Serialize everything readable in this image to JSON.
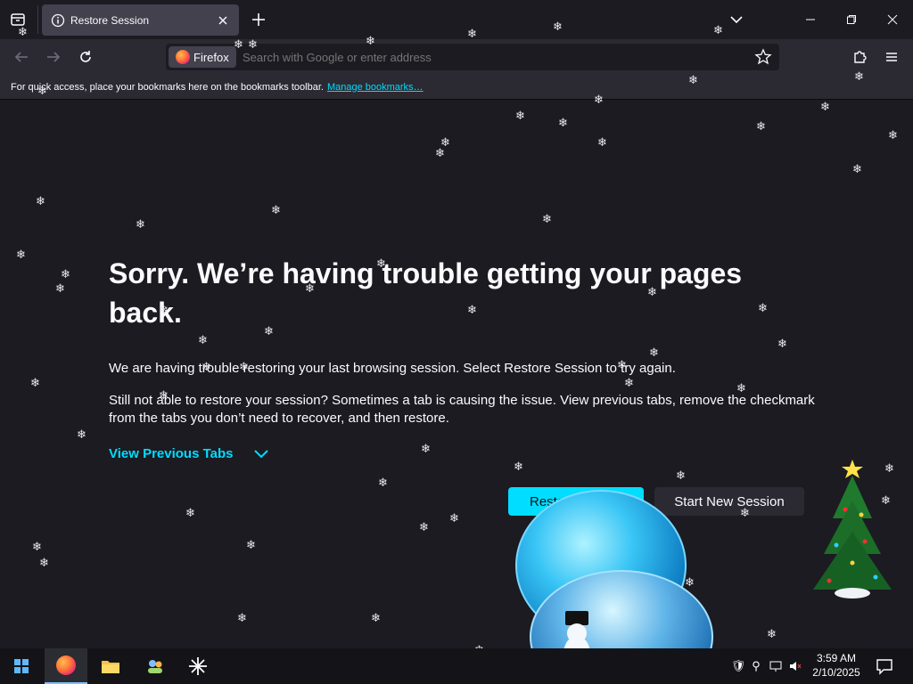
{
  "tabs": [
    {
      "title": "Restore Session"
    }
  ],
  "urlbar": {
    "identity_label": "Firefox",
    "placeholder": "Search with Google or enter address"
  },
  "bookmarks_bar": {
    "text": "For quick access, place your bookmarks here on the bookmarks toolbar.",
    "link": "Manage bookmarks…"
  },
  "page": {
    "heading": "Sorry. We’re having trouble getting your pages back.",
    "paragraph1": "We are having trouble restoring your last browsing session. Select Restore Session to try again.",
    "paragraph2": "Still not able to restore your session? Sometimes a tab is causing the issue. View previous tabs, remove the checkmark from the tabs you don’t need to recover, and then restore.",
    "view_previous_tabs": "View Previous Tabs",
    "restore_button": "Resto",
    "new_session_button": "Start New Session"
  },
  "taskbar": {
    "time": "3:59 AM",
    "date": "2/10/2025"
  },
  "colors": {
    "accent": "#00ddff",
    "background": "#1c1b22",
    "toolbar": "#2b2a33"
  },
  "icons": [
    "tab-list-icon",
    "info-icon",
    "close-icon",
    "plus-icon",
    "chevron-down-icon",
    "minimize-icon",
    "maximize-icon",
    "back-icon",
    "forward-icon",
    "reload-icon",
    "star-icon",
    "extensions-icon",
    "menu-icon",
    "windows-start-icon",
    "firefox-icon",
    "file-explorer-icon",
    "notification-icon"
  ]
}
